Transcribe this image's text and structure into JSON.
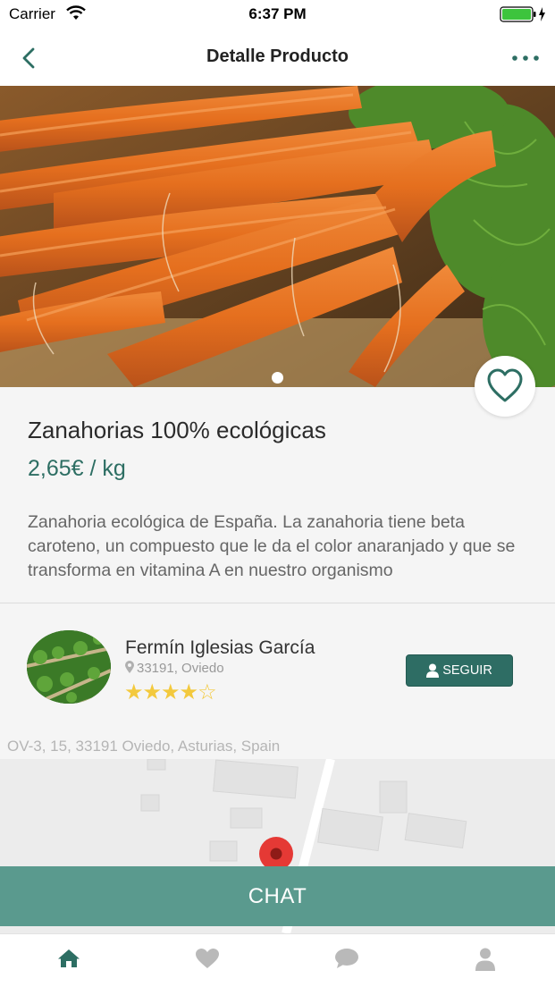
{
  "status_bar": {
    "carrier": "Carrier",
    "time": "6:37 PM"
  },
  "nav": {
    "title": "Detalle Producto",
    "back_icon": "chevron-left-icon",
    "more_icon": "more-dots-icon"
  },
  "product": {
    "image": "carrots-photo",
    "name": "Zanahorias 100% ecológicas",
    "price": "2,65€ / kg",
    "description": "Zanahoria ecológica de España. La zanahoria tiene beta caroteno, un compuesto que le da el color anaranjado y que se transforma en vitamina A en nuestro organismo",
    "favorite_icon": "heart-outline-icon"
  },
  "seller": {
    "name": "Fermín Iglesias García",
    "location": "33191, Oviedo",
    "rating": 4,
    "rating_max": 5,
    "stars_full": "★★★★",
    "stars_empty": "☆",
    "follow_label": "SEGUIR"
  },
  "map": {
    "address": "OV-3, 15, 33191 Oviedo, Asturias, Spain"
  },
  "chat_label": "CHAT",
  "tabs": [
    {
      "icon": "home-icon",
      "active": true
    },
    {
      "icon": "heart-icon",
      "active": false
    },
    {
      "icon": "chat-bubble-icon",
      "active": false
    },
    {
      "icon": "user-icon",
      "active": false
    }
  ],
  "colors": {
    "accent": "#2d6e63",
    "chat_button": "#5a9a8e",
    "star": "#f3c93d",
    "tab_inactive": "#b9b9b9"
  }
}
